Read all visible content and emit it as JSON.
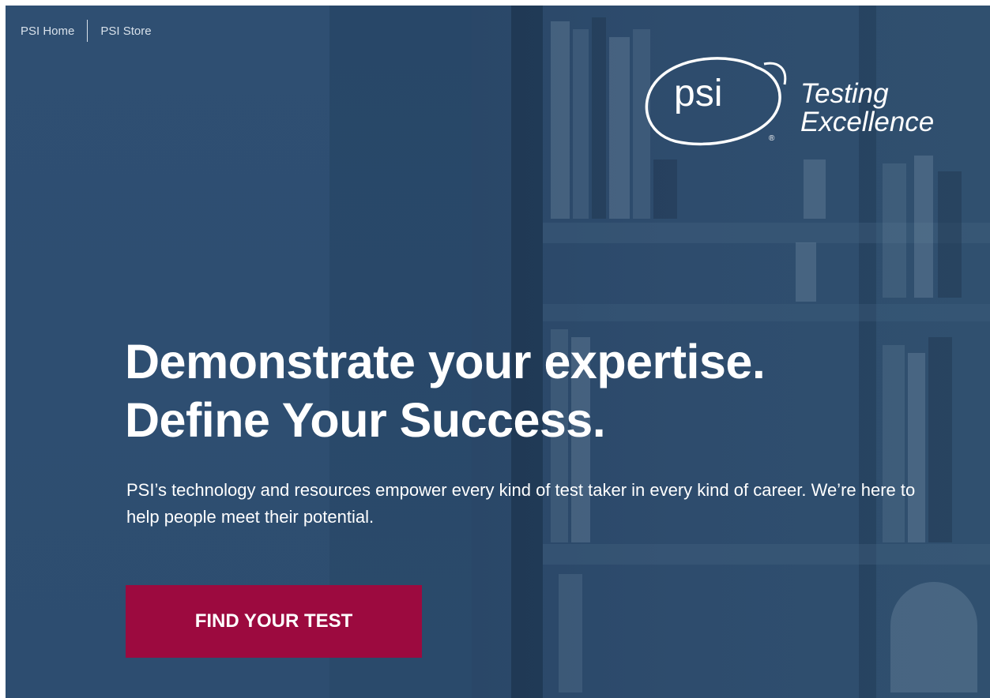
{
  "nav": {
    "items": [
      {
        "label": "PSI Home"
      },
      {
        "label": "PSI Store"
      }
    ]
  },
  "logo": {
    "word": "psi",
    "registered": "®",
    "tagline_line1": "Testing",
    "tagline_line2": "Excellence"
  },
  "hero": {
    "headline_line1": "Demonstrate your expertise.",
    "headline_line2": "Define Your Success.",
    "subtext": "PSI’s technology and resources empower every kind of test taker in every kind of career. We’re here to help people meet their potential.",
    "cta_label": "FIND YOUR TEST"
  },
  "colors": {
    "background": "#2b4a6b",
    "cta": "#9c0a3f",
    "text": "#ffffff"
  }
}
